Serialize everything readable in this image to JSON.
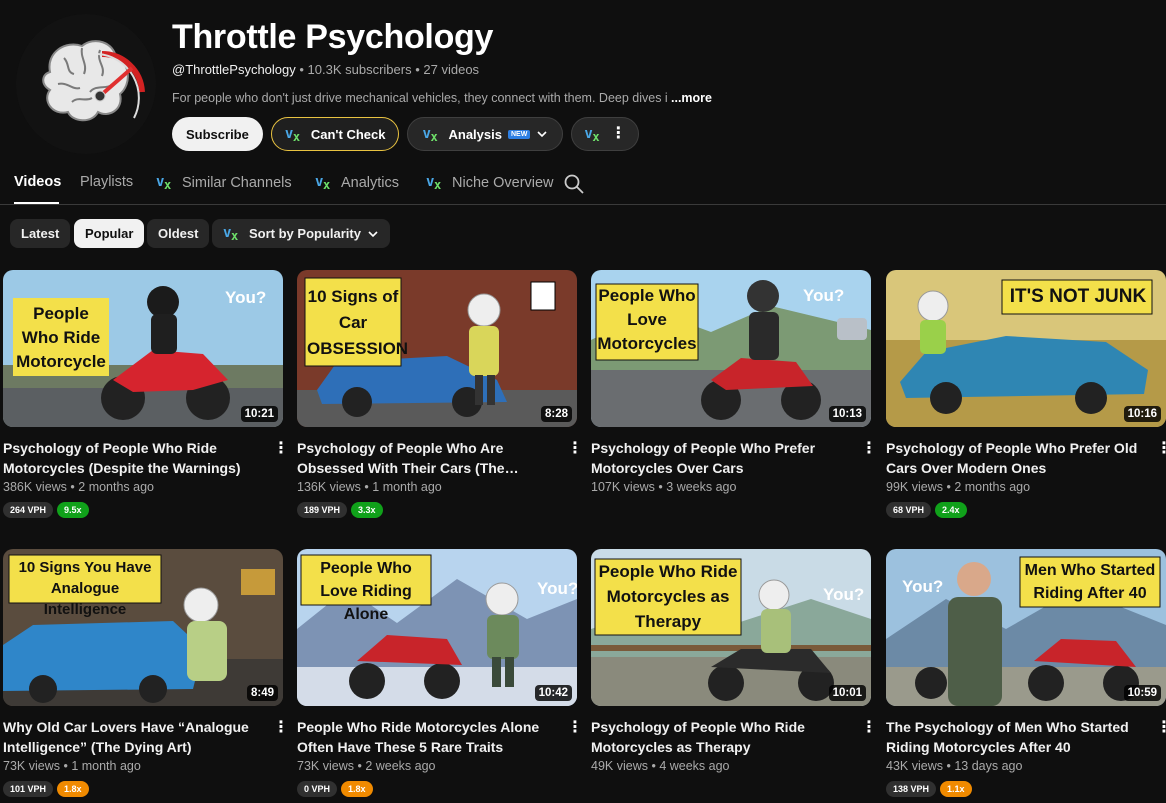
{
  "channel": {
    "name": "Throttle Psychology",
    "handle": "@ThrottlePsychology",
    "subscribers": "10.3K subscribers",
    "videos_count": "27 videos",
    "description": "For people who don't just drive mechanical vehicles, they connect with them. Deep dives i",
    "more_label": "...more"
  },
  "actions": {
    "subscribe": "Subscribe",
    "cant_check": "Can't Check",
    "analysis": "Analysis",
    "new_badge": "NEW"
  },
  "tabs": [
    {
      "label": "Videos"
    },
    {
      "label": "Playlists"
    },
    {
      "label": "Similar Channels"
    },
    {
      "label": "Analytics"
    },
    {
      "label": "Niche Overview"
    }
  ],
  "chips": [
    {
      "label": "Latest"
    },
    {
      "label": "Popular"
    },
    {
      "label": "Oldest"
    },
    {
      "label": "Sort by Popularity"
    }
  ],
  "videos": [
    {
      "thumb_text": "People Who Ride Motorcycle",
      "thumb_you": "You?",
      "duration": "10:21",
      "title": "Psychology of People Who Ride Motorcycles (Despite the Warnings)",
      "views": "386K views",
      "age": "2 months ago",
      "vph": "264 VPH",
      "ratio": "9.5x",
      "ratio_color": "#10a11a"
    },
    {
      "thumb_text": "10 Signs of Car OBSESSION",
      "thumb_you": "",
      "duration": "8:28",
      "title": "Psychology of People Who Are Obsessed With Their Cars (The Hidde...",
      "views": "136K views",
      "age": "1 month ago",
      "vph": "189 VPH",
      "ratio": "3.3x",
      "ratio_color": "#10a11a"
    },
    {
      "thumb_text": "People Who Love Motorcycles",
      "thumb_you": "You?",
      "duration": "10:13",
      "title": "Psychology of People Who Prefer Motorcycles Over Cars",
      "views": "107K views",
      "age": "3 weeks ago",
      "vph": "",
      "ratio": "",
      "ratio_color": ""
    },
    {
      "thumb_text": "IT'S NOT JUNK",
      "thumb_you": "",
      "duration": "10:16",
      "title": "Psychology of People Who Prefer Old Cars Over Modern Ones",
      "views": "99K views",
      "age": "2 months ago",
      "vph": "68 VPH",
      "ratio": "2.4x",
      "ratio_color": "#10a11a"
    },
    {
      "thumb_text": "10 Signs You Have Analogue Intelligence",
      "thumb_you": "",
      "duration": "8:49",
      "title": "Why Old Car Lovers Have “Analogue Intelligence” (The Dying Art)",
      "views": "73K views",
      "age": "1 month ago",
      "vph": "101 VPH",
      "ratio": "1.8x",
      "ratio_color": "#f08a00"
    },
    {
      "thumb_text": "People Who Love Riding Alone",
      "thumb_you": "You?",
      "duration": "10:42",
      "title": "People Who Ride Motorcycles Alone Often Have These 5 Rare Traits",
      "views": "73K views",
      "age": "2 weeks ago",
      "vph": "0 VPH",
      "ratio": "1.8x",
      "ratio_color": "#f08a00"
    },
    {
      "thumb_text": "People Who Ride Motorcycles as Therapy",
      "thumb_you": "You?",
      "duration": "10:01",
      "title": "Psychology of People Who Ride Motorcycles as Therapy",
      "views": "49K views",
      "age": "4 weeks ago",
      "vph": "",
      "ratio": "",
      "ratio_color": ""
    },
    {
      "thumb_text": "Men Who Started Riding After 40",
      "thumb_you": "You?",
      "duration": "10:59",
      "title": "The Psychology of Men Who Started Riding Motorcycles After 40",
      "views": "43K views",
      "age": "13 days ago",
      "vph": "138 VPH",
      "ratio": "1.1x",
      "ratio_color": "#f08a00"
    }
  ]
}
